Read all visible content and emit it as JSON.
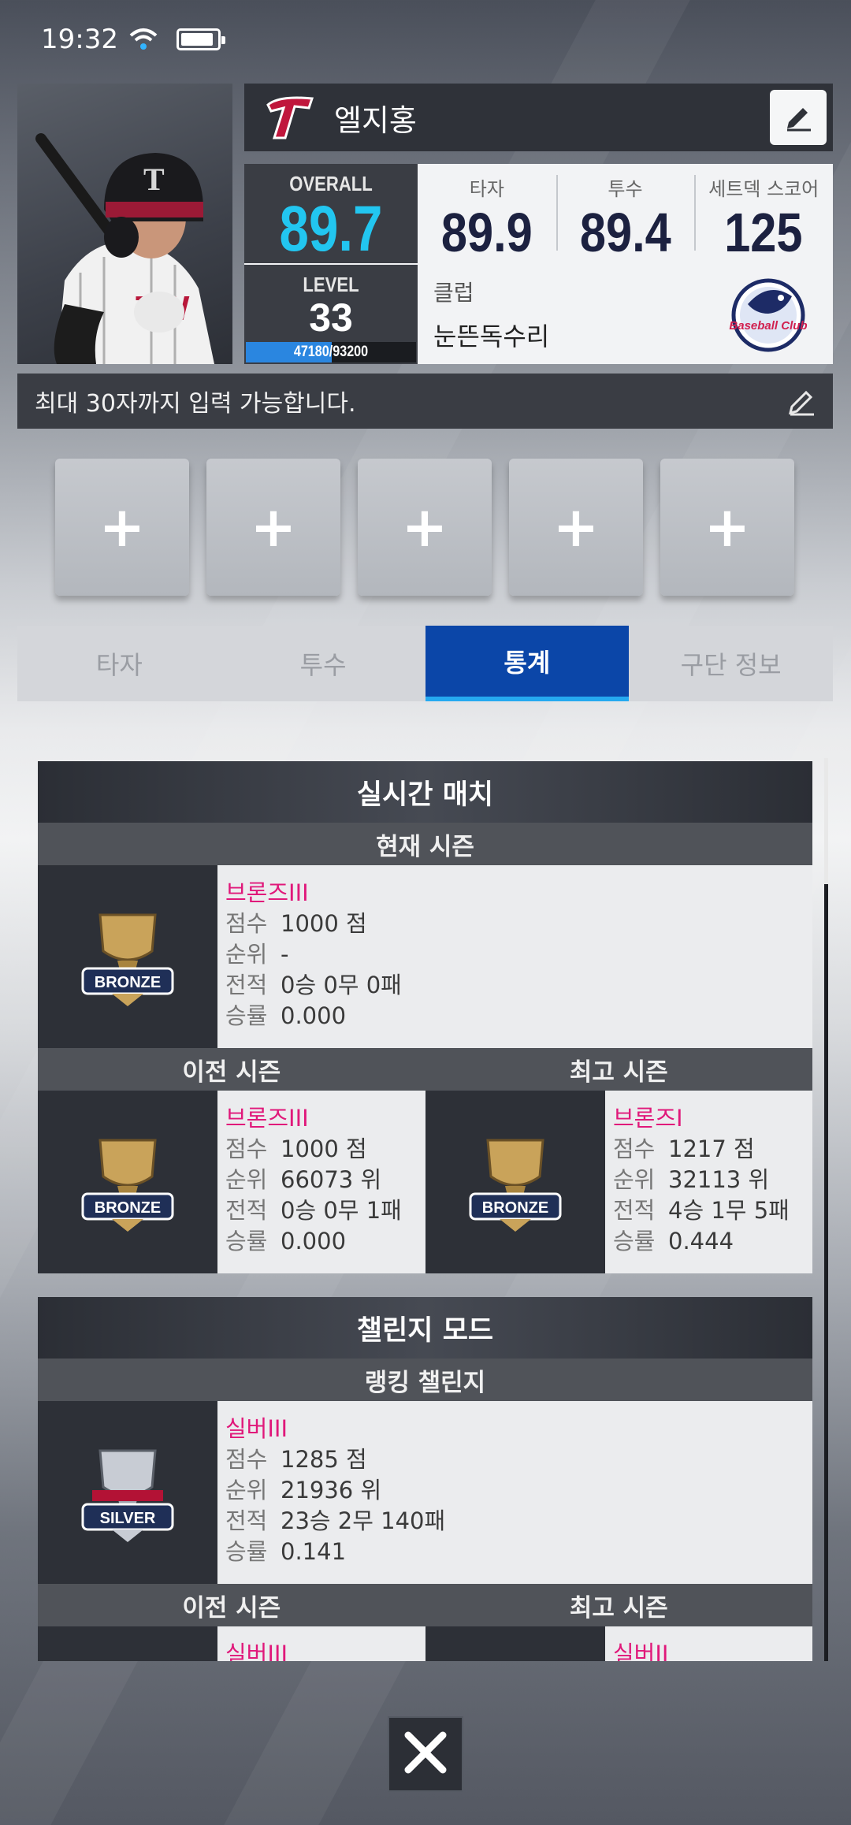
{
  "status_bar": {
    "time": "19:32"
  },
  "player": {
    "name": "엘지홍",
    "overall_label": "OVERALL",
    "overall_value": "89.7",
    "level_label": "LEVEL",
    "level_value": "33",
    "exp_text": "47180/93200",
    "exp_progress": 0.506,
    "stats": [
      {
        "label": "타자",
        "value": "89.9"
      },
      {
        "label": "투수",
        "value": "89.4"
      },
      {
        "label": "세트덱 스코어",
        "value": "125"
      }
    ],
    "club_label": "클럽",
    "club_name": "눈뜬독수리",
    "club_logo_text": "Baseball Club"
  },
  "bio": {
    "text": "최대 30자까지 입력 가능합니다."
  },
  "slots": [
    "+",
    "+",
    "+",
    "+",
    "+"
  ],
  "tabs": [
    {
      "label": "타자",
      "active": false
    },
    {
      "label": "투수",
      "active": false
    },
    {
      "label": "통계",
      "active": true
    },
    {
      "label": "구단 정보",
      "active": false
    }
  ],
  "realtime": {
    "title": "실시간 매치",
    "current_title": "현재 시즌",
    "current": {
      "tier": "브론즈III",
      "score_key": "점수",
      "score": "1000 점",
      "rank_key": "순위",
      "rank": "-",
      "record_key": "전적",
      "record": "0승 0무 0패",
      "rate_key": "승률",
      "rate": "0.000",
      "badge": "BRONZE"
    },
    "prev_title": "이전 시즌",
    "best_title": "최고 시즌",
    "prev": {
      "tier": "브론즈III",
      "score_key": "점수",
      "score": "1000 점",
      "rank_key": "순위",
      "rank": "66073 위",
      "record_key": "전적",
      "record": "0승 0무 1패",
      "rate_key": "승률",
      "rate": "0.000",
      "badge": "BRONZE"
    },
    "best": {
      "tier": "브론즈I",
      "score_key": "점수",
      "score": "1217 점",
      "rank_key": "순위",
      "rank": "32113 위",
      "record_key": "전적",
      "record": "4승 1무 5패",
      "rate_key": "승률",
      "rate": "0.444",
      "badge": "BRONZE"
    }
  },
  "challenge": {
    "title": "챌린지 모드",
    "ranking_title": "랭킹 챌린지",
    "ranking": {
      "tier": "실버III",
      "score_key": "점수",
      "score": "1285 점",
      "rank_key": "순위",
      "rank": "21936 위",
      "record_key": "전적",
      "record": "23승 2무 140패",
      "rate_key": "승률",
      "rate": "0.141",
      "badge": "SILVER"
    },
    "prev_title": "이전 시즌",
    "best_title": "최고 시즌",
    "prev_tier": "실버III",
    "best_tier": "실버II"
  },
  "colors": {
    "accent_blue": "#22c6f0",
    "tab_active": "#0b46a8",
    "tier_pink": "#e0187a"
  }
}
